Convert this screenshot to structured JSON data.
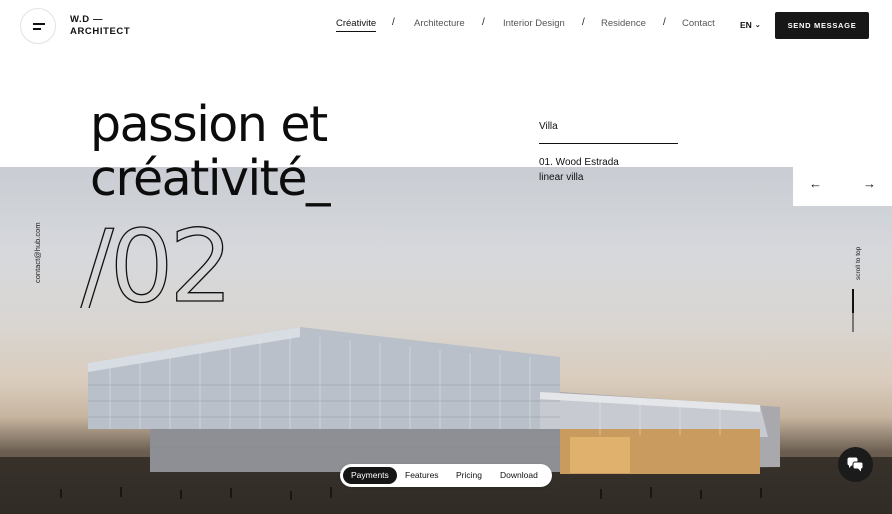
{
  "brand": {
    "line1": "W.D —",
    "line2": "ARCHITECT"
  },
  "nav": {
    "items": [
      {
        "label": "Créativite",
        "active": true
      },
      {
        "label": "Architecture",
        "active": false
      },
      {
        "label": "Interior Design",
        "active": false
      },
      {
        "label": "Residence",
        "active": false
      },
      {
        "label": "Contact",
        "active": false
      }
    ],
    "separator": "/"
  },
  "language": {
    "current": "EN"
  },
  "cta": {
    "send_label": "SEND MESSAGE"
  },
  "hero": {
    "headline_line1": "passion et",
    "headline_line2": "créativité_",
    "slide_number": "/02",
    "category": "Villa",
    "project_line1": "01. Wood Estrada",
    "project_line2": "linear villa"
  },
  "side": {
    "contact_email": "contact@hub.com",
    "scroll_label": "scroll to top"
  },
  "tabs": {
    "items": [
      {
        "label": "Payments",
        "active": true
      },
      {
        "label": "Features",
        "active": false
      },
      {
        "label": "Pricing",
        "active": false
      },
      {
        "label": "Download",
        "active": false
      }
    ]
  },
  "colors": {
    "accent": "#171717",
    "background": "#ffffff"
  },
  "icons": {
    "menu": "menu-icon",
    "chevron": "chevron-down-icon",
    "prev": "arrow-left-icon",
    "next": "arrow-right-icon",
    "chat": "chat-icon"
  }
}
